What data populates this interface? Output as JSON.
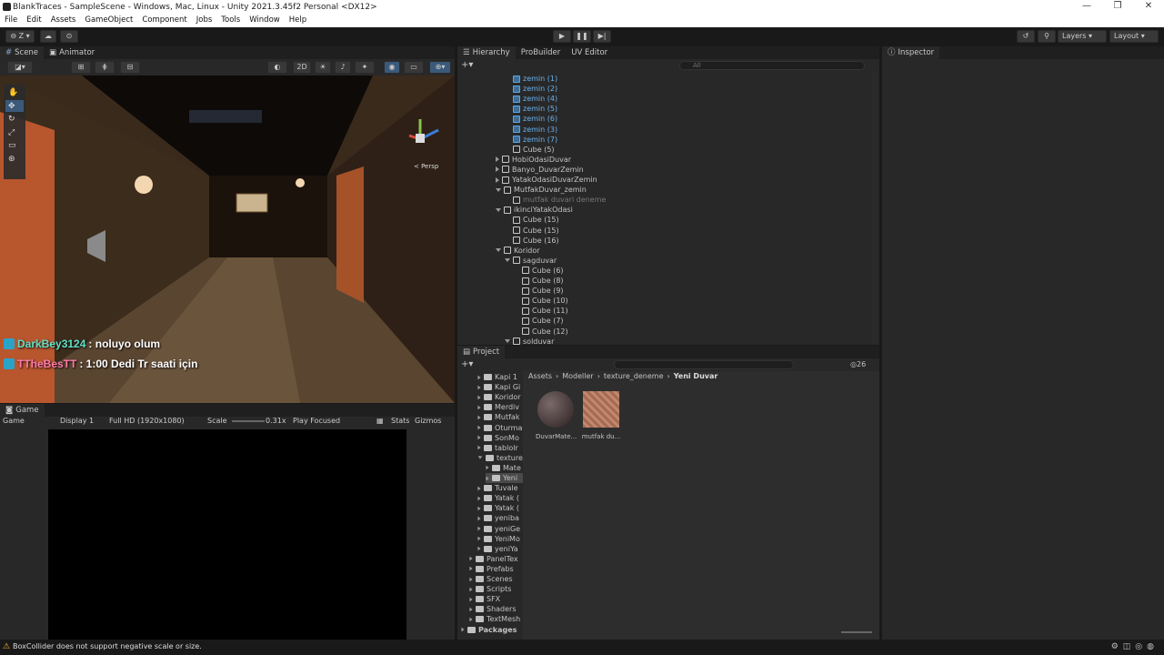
{
  "window": {
    "title": "BlankTraces - SampleScene - Windows, Mac, Linux - Unity 2021.3.45f2 Personal <DX12>",
    "controls": [
      "—",
      "❐",
      "✕"
    ]
  },
  "menu": [
    "File",
    "Edit",
    "Assets",
    "GameObject",
    "Component",
    "Jobs",
    "Tools",
    "Window",
    "Help"
  ],
  "toolbar": {
    "account": "Z",
    "layers": "Layers",
    "layout": "Layout"
  },
  "scene": {
    "tabs": [
      "Scene",
      "Animator"
    ],
    "mode_2d": "2D",
    "persp": "< Persp"
  },
  "chat": [
    {
      "user": "DarkBey3124",
      "msg": " : noluyo olum",
      "color": "#5fe0c8"
    },
    {
      "user": "TTheBesTT",
      "msg": " : 1:00 Dedi Tr saati için",
      "color": "#ff7aa8"
    }
  ],
  "game": {
    "tab": "Game",
    "mode": "Game",
    "display": "Display 1",
    "resolution": "Full HD (1920x1080)",
    "scale_label": "Scale",
    "scale": "0.31x",
    "play": "Play Focused",
    "stats": "Stats",
    "gizmos": "Gizmos"
  },
  "hierarchy": {
    "tabs": [
      "Hierarchy",
      "ProBuilder",
      "UV Editor"
    ],
    "search_placeholder": "All",
    "rows": [
      {
        "label": "zemin (1)",
        "indent": 3,
        "blue": true,
        "arrow": ""
      },
      {
        "label": "zemin (2)",
        "indent": 3,
        "blue": true,
        "arrow": ""
      },
      {
        "label": "zemin (4)",
        "indent": 3,
        "blue": true,
        "arrow": ""
      },
      {
        "label": "zemin (5)",
        "indent": 3,
        "blue": true,
        "arrow": ""
      },
      {
        "label": "zemin (6)",
        "indent": 3,
        "blue": true,
        "arrow": ""
      },
      {
        "label": "zemin (3)",
        "indent": 3,
        "blue": true,
        "arrow": ""
      },
      {
        "label": "zemin (7)",
        "indent": 3,
        "blue": true,
        "arrow": ""
      },
      {
        "label": "Cube (5)",
        "indent": 3,
        "blue": false,
        "arrow": ""
      },
      {
        "label": "HobiOdasiDuvar",
        "indent": 2,
        "blue": false,
        "arrow": "r"
      },
      {
        "label": "Banyo_DuvarZemin",
        "indent": 2,
        "blue": false,
        "arrow": "r"
      },
      {
        "label": "YatakOdasiDuvarZemin",
        "indent": 2,
        "blue": false,
        "arrow": "r"
      },
      {
        "label": "MutfakDuvar_zemin",
        "indent": 2,
        "blue": false,
        "arrow": "d"
      },
      {
        "label": "mutfak duvari deneme",
        "indent": 3,
        "blue": false,
        "arrow": "",
        "dim": true
      },
      {
        "label": "ikinciYatakOdasi",
        "indent": 2,
        "blue": false,
        "arrow": "d"
      },
      {
        "label": "Cube (15)",
        "indent": 3,
        "blue": false,
        "arrow": ""
      },
      {
        "label": "Cube (15)",
        "indent": 3,
        "blue": false,
        "arrow": ""
      },
      {
        "label": "Cube (16)",
        "indent": 3,
        "blue": false,
        "arrow": ""
      },
      {
        "label": "Koridor",
        "indent": 2,
        "blue": false,
        "arrow": "d"
      },
      {
        "label": "sagduvar",
        "indent": 3,
        "blue": false,
        "arrow": "d"
      },
      {
        "label": "Cube (6)",
        "indent": 4,
        "blue": false,
        "arrow": ""
      },
      {
        "label": "Cube (8)",
        "indent": 4,
        "blue": false,
        "arrow": ""
      },
      {
        "label": "Cube (9)",
        "indent": 4,
        "blue": false,
        "arrow": ""
      },
      {
        "label": "Cube (10)",
        "indent": 4,
        "blue": false,
        "arrow": ""
      },
      {
        "label": "Cube (11)",
        "indent": 4,
        "blue": false,
        "arrow": ""
      },
      {
        "label": "Cube (7)",
        "indent": 4,
        "blue": false,
        "arrow": ""
      },
      {
        "label": "Cube (12)",
        "indent": 4,
        "blue": false,
        "arrow": ""
      },
      {
        "label": "solduvar",
        "indent": 3,
        "blue": false,
        "arrow": "d"
      }
    ]
  },
  "project": {
    "tab": "Project",
    "breadcrumb": [
      "Assets",
      "Modeller",
      "texture_deneme",
      "Yeni Duvar"
    ],
    "count": "26",
    "folders": [
      {
        "label": "Kapi 1",
        "indent": 2
      },
      {
        "label": "Kapi Gi",
        "indent": 2
      },
      {
        "label": "Koridor",
        "indent": 2
      },
      {
        "label": "Merdiv",
        "indent": 2
      },
      {
        "label": "Mutfak",
        "indent": 2
      },
      {
        "label": "Oturma",
        "indent": 2
      },
      {
        "label": "SonMo",
        "indent": 2
      },
      {
        "label": "tablolr",
        "indent": 2
      },
      {
        "label": "texture",
        "indent": 2,
        "open": true
      },
      {
        "label": "Mate",
        "indent": 3
      },
      {
        "label": "Yeni",
        "indent": 3,
        "selected": true
      },
      {
        "label": "Tuvale",
        "indent": 2
      },
      {
        "label": "Yatak (",
        "indent": 2
      },
      {
        "label": "Yatak (",
        "indent": 2
      },
      {
        "label": "yeniba",
        "indent": 2
      },
      {
        "label": "yeniGe",
        "indent": 2
      },
      {
        "label": "YeniMo",
        "indent": 2
      },
      {
        "label": "yeniYa",
        "indent": 2
      },
      {
        "label": "PanelTex",
        "indent": 1
      },
      {
        "label": "Prefabs",
        "indent": 1
      },
      {
        "label": "Scenes",
        "indent": 1
      },
      {
        "label": "Scripts",
        "indent": 1
      },
      {
        "label": "SFX",
        "indent": 1
      },
      {
        "label": "Shaders",
        "indent": 1
      },
      {
        "label": "TextMesh",
        "indent": 1
      },
      {
        "label": "Packages",
        "indent": 0,
        "bold": true
      }
    ],
    "assets": [
      {
        "label": "DuvarMate...",
        "kind": "sphere"
      },
      {
        "label": "mutfak du...",
        "kind": "texture"
      }
    ]
  },
  "inspector": {
    "tab": "Inspector"
  },
  "status": {
    "message": "BoxCollider does not support negative scale or size."
  }
}
